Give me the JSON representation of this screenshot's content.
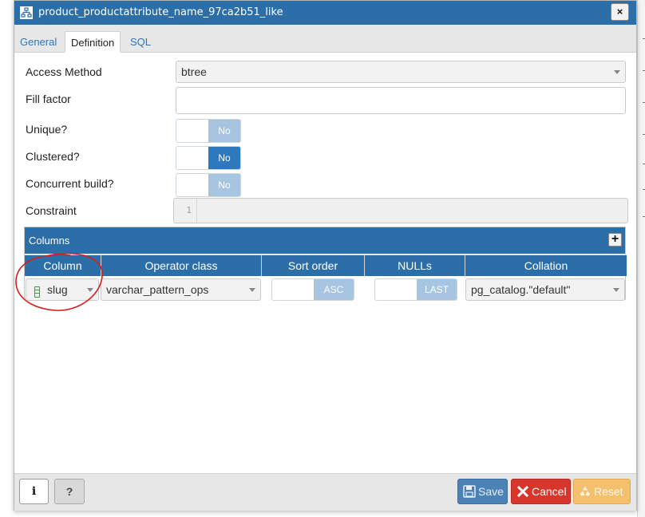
{
  "dialog": {
    "title": "product_productattribute_name_97ca2b51_like",
    "close_label": "×"
  },
  "tabs": [
    {
      "label": "General",
      "active": false
    },
    {
      "label": "Definition",
      "active": true
    },
    {
      "label": "SQL",
      "active": false
    }
  ],
  "form": {
    "access_method": {
      "label": "Access Method",
      "value": "btree"
    },
    "fill_factor": {
      "label": "Fill factor",
      "value": ""
    },
    "unique": {
      "label": "Unique?",
      "value": "No"
    },
    "clustered": {
      "label": "Clustered?",
      "value": "No"
    },
    "concurrent_build": {
      "label": "Concurrent build?",
      "value": "No"
    },
    "constraint": {
      "label": "Constraint",
      "line_number": "1",
      "value": ""
    }
  },
  "columns_panel": {
    "title": "Columns",
    "add_label": "+",
    "headers": [
      "Column",
      "Operator class",
      "Sort order",
      "NULLs",
      "Collation"
    ],
    "rows": [
      {
        "column": "slug",
        "operator_class": "varchar_pattern_ops",
        "sort_order": "ASC",
        "nulls": "LAST",
        "collation": "pg_catalog.\"default\""
      }
    ]
  },
  "footer": {
    "info_label": "i",
    "help_label": "?",
    "save_label": "Save",
    "cancel_label": "Cancel",
    "reset_label": "Reset"
  },
  "colors": {
    "titlebar": "#2c6ea8",
    "toggle_dark": "#2e78bd",
    "toggle_light": "#a7c5e0",
    "cancel": "#d6362c",
    "reset": "#f5c06e",
    "annotation": "#d81e1e"
  }
}
